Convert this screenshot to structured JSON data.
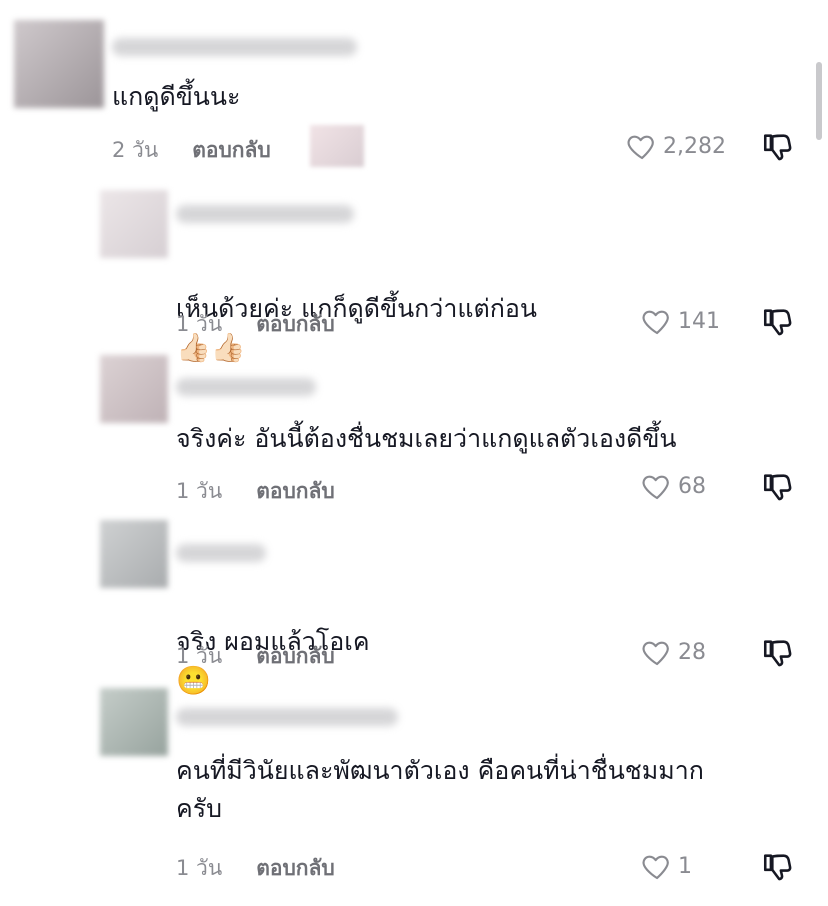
{
  "comments": [
    {
      "text": "แกดูดีขึ้นนะ",
      "time": "2 วัน",
      "reply": "ตอบกลับ",
      "likes": "2,282"
    },
    {
      "text": "เห็นด้วยค่ะ แกก็ดูดีขึ้นกว่าแต่ก่อน",
      "emoji": "👍🏻👍🏻",
      "time": "1 วัน",
      "reply": "ตอบกลับ",
      "likes": "141"
    },
    {
      "text": "จริงค่ะ อันนี้ต้องชื่นชมเลยว่าแกดูแลตัวเองดีขึ้น",
      "time": "1 วัน",
      "reply": "ตอบกลับ",
      "likes": "68"
    },
    {
      "text": "จริง ผอมแล้วโอเค",
      "emoji": "😬",
      "time": "1 วัน",
      "reply": "ตอบกลับ",
      "likes": "28"
    },
    {
      "text": "คนที่มีวินัยและพัฒนาตัวเอง คือคนที่น่าชื่นชมมาก\nครับ",
      "time": "1 วัน",
      "reply": "ตอบกลับ",
      "likes": "1"
    }
  ],
  "icons": {
    "like": "heart-outline-icon",
    "dislike": "thumbs-down-icon"
  },
  "colors": {
    "text": "#161823",
    "meta": "#8a8b91"
  }
}
